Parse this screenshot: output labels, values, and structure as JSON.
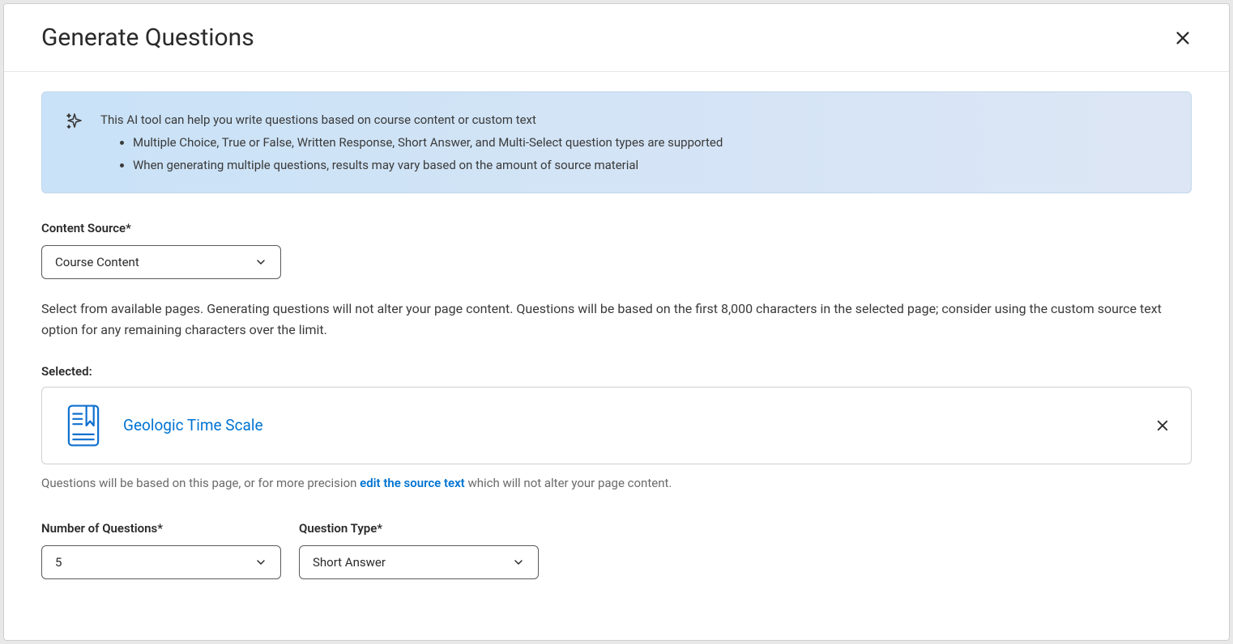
{
  "modal": {
    "title": "Generate Questions"
  },
  "banner": {
    "intro": "This AI tool can help you write questions based on course content or custom text",
    "bullets": [
      "Multiple Choice, True or False, Written Response, Short Answer, and Multi-Select question types are supported",
      "When generating multiple questions, results may vary based on the amount of source material"
    ]
  },
  "content_source": {
    "label": "Content Source*",
    "selected": "Course Content",
    "helper": "Select from available pages. Generating questions will not alter your page content. Questions will be based on the first 8,000 characters in the selected page; consider using the custom source text option for any remaining characters over the limit."
  },
  "selected_page": {
    "label": "Selected:",
    "title": "Geologic Time Scale",
    "hint_prefix": "Questions will be based on this page, or for more precision ",
    "hint_link": "edit the source text",
    "hint_suffix": " which will not alter your page content."
  },
  "num_questions": {
    "label": "Number of Questions*",
    "value": "5"
  },
  "question_type": {
    "label": "Question Type*",
    "value": "Short Answer"
  }
}
